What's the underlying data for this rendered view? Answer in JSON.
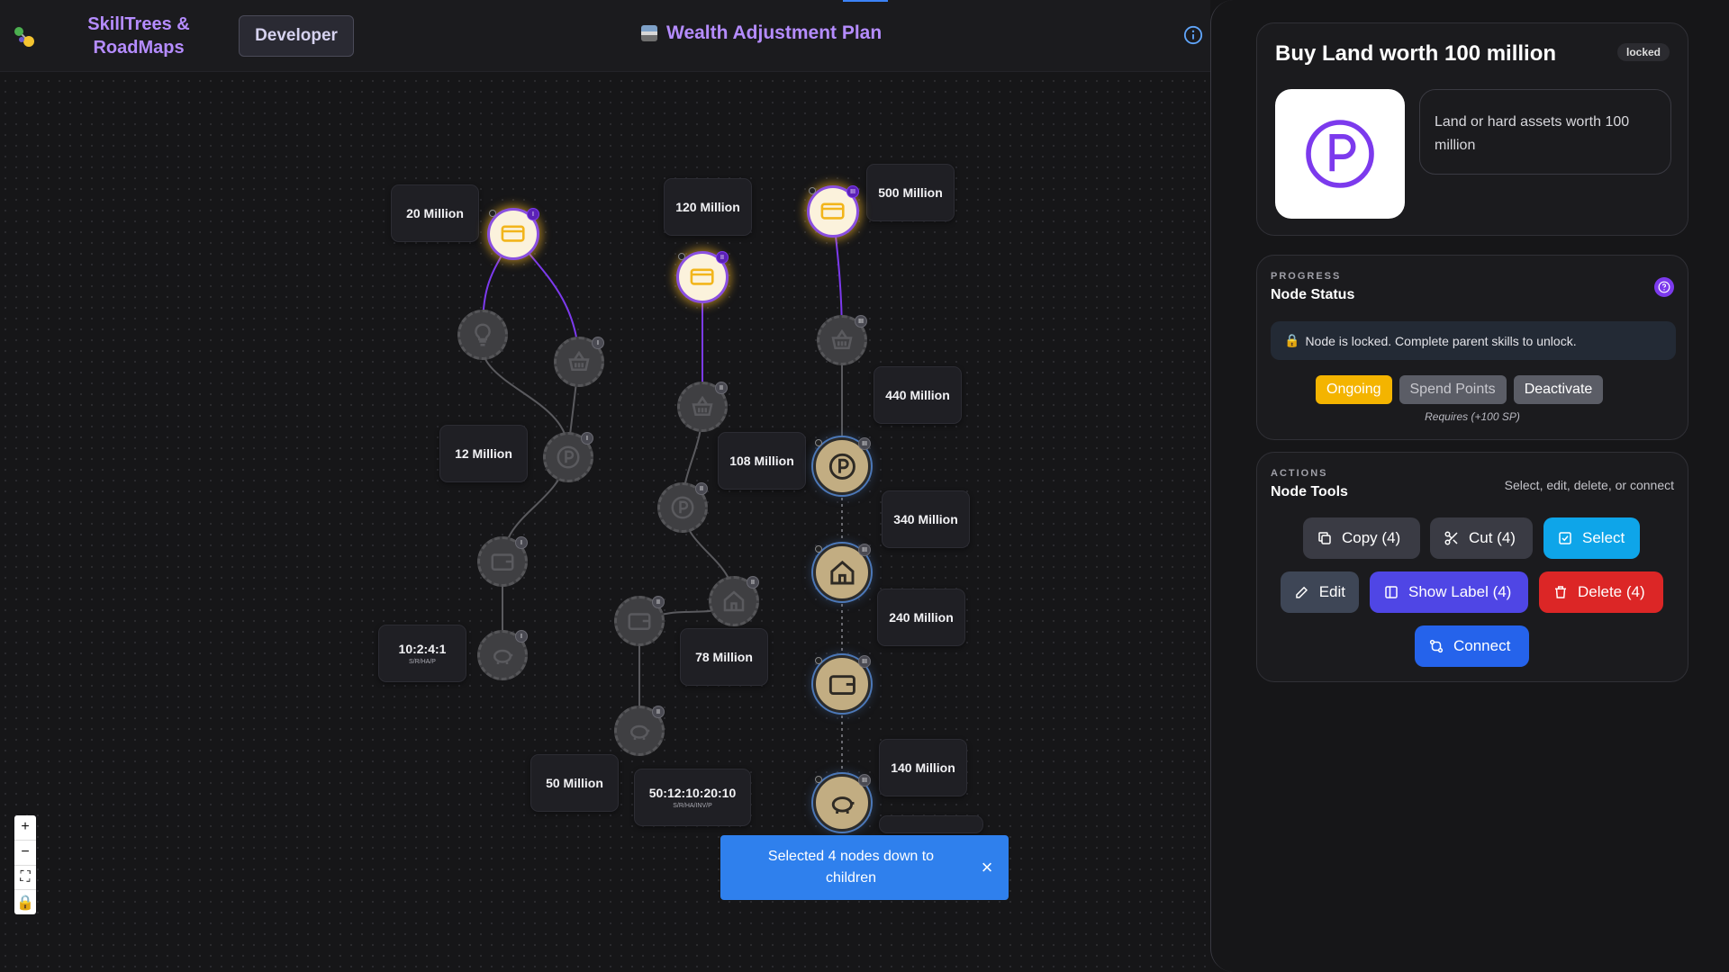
{
  "app": {
    "brand": "SkillTrees & RoadMaps",
    "mode_button": "Developer",
    "plan_title": "Wealth Adjustment Plan"
  },
  "canvas": {
    "labels": {
      "m20": "20 Million",
      "m120": "120 Million",
      "m500": "500 Million",
      "m12": "12 Million",
      "m108": "108 Million",
      "m440": "440 Million",
      "m340": "340 Million",
      "m240": "240 Million",
      "ratio1": "10:2:4:1",
      "ratio1_sub": "S/R/HA/P",
      "m78": "78 Million",
      "m50": "50 Million",
      "ratio2": "50:12:10:20:10",
      "ratio2_sub": "S/R/HA/INV/P",
      "m140": "140 Million"
    },
    "node_badges": {
      "b1": "I",
      "b2": "II",
      "b3": "III",
      "b4": "I",
      "b5": "I",
      "b6": "I",
      "b7": "I",
      "b8": "I",
      "b9": "II",
      "b10": "II",
      "b11": "II",
      "b12": "II",
      "b13": "II",
      "b14": "III",
      "b15": "III",
      "b16": "III",
      "b17": "III",
      "b18": "III"
    }
  },
  "toast": {
    "message": "Selected 4 nodes down to children"
  },
  "panel": {
    "node_title": "Buy Land worth 100 million",
    "status_pill": "locked",
    "description": "Land or hard assets worth 100 million",
    "progress": {
      "eyebrow": "PROGRESS",
      "title": "Node Status",
      "lock_message": "Node is locked. Complete parent skills to unlock.",
      "buttons": {
        "ongoing": "Ongoing",
        "spend": "Spend Points",
        "deactivate": "Deactivate"
      },
      "requires": "Requires (+100 SP)"
    },
    "actions": {
      "eyebrow": "ACTIONS",
      "title": "Node Tools",
      "hint": "Select, edit, delete, or connect",
      "copy": "Copy (4)",
      "cut": "Cut (4)",
      "select": "Select",
      "edit": "Edit",
      "show_label": "Show Label (4)",
      "delete": "Delete (4)",
      "connect": "Connect"
    }
  },
  "colors": {
    "accent": "#b58cff",
    "active_node_glow": "#ffbe28",
    "selected_ring": "#4c78b8",
    "ongoing": "#f4b400",
    "delete": "#dc2626",
    "connect": "#2563eb"
  }
}
